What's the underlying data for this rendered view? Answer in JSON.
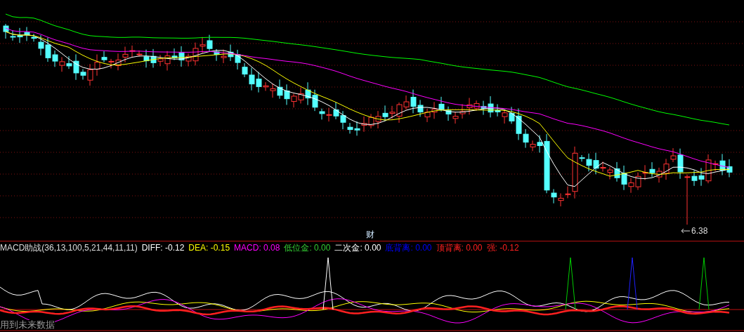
{
  "price_chart": {
    "event_label": "财",
    "low_marker": "6.38"
  },
  "indicator": {
    "name": "MACD助战(36,13,100,5,21,44,11,11)",
    "readings": [
      {
        "label": "DIFF:",
        "value": "-0.12",
        "color": "#ffffff"
      },
      {
        "label": "DEA:",
        "value": "-0.15",
        "color": "#ffff00"
      },
      {
        "label": "MACD:",
        "value": "0.08",
        "color": "#ff00ff"
      },
      {
        "label": "低位金:",
        "value": "0.00",
        "color": "#33cc33"
      },
      {
        "label": "二次金:",
        "value": "0.00",
        "color": "#ffffff"
      },
      {
        "label": "底背离:",
        "value": "0.00",
        "color": "#0000ff"
      },
      {
        "label": "顶背离:",
        "value": "0.00",
        "color": "#ff2020"
      },
      {
        "label": "强:",
        "value": "-0.12",
        "color": "#ff2020"
      }
    ],
    "note": "用到未来数据"
  }
}
